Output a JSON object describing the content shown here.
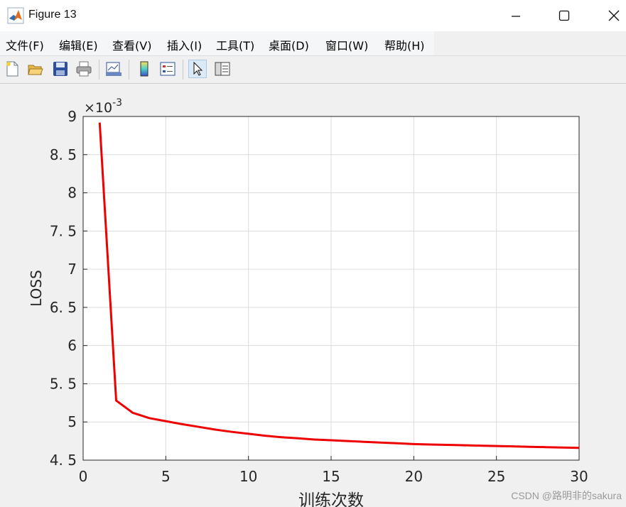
{
  "window": {
    "title": "Figure 13",
    "minimize_icon": "minimize-icon",
    "maximize_icon": "maximize-icon",
    "close_icon": "close-icon"
  },
  "menu": {
    "items": [
      "文件(F)",
      "编辑(E)",
      "查看(V)",
      "插入(I)",
      "工具(T)",
      "桌面(D)",
      "窗口(W)",
      "帮助(H)"
    ]
  },
  "toolbar": {
    "icons": [
      "new-figure-icon",
      "open-file-icon",
      "save-icon",
      "print-icon",
      "link-plot-icon",
      "colorbar-icon",
      "legend-icon",
      "pointer-icon",
      "property-editor-icon"
    ]
  },
  "chart_data": {
    "type": "line",
    "title": "",
    "xlabel": "训练次数",
    "ylabel": "LOSS",
    "exponent_label": "×10",
    "exponent_power": "-3",
    "xlim": [
      0,
      30
    ],
    "ylim": [
      4.5,
      9
    ],
    "xticks": [
      "0",
      "5",
      "10",
      "15",
      "20",
      "25",
      "30"
    ],
    "yticks": [
      "4. 5",
      "5",
      "5. 5",
      "6",
      "6. 5",
      "7",
      "7. 5",
      "8",
      "8. 5",
      "9"
    ],
    "grid": true,
    "series": [
      {
        "color": "#ee0000",
        "x": [
          1,
          2,
          3,
          4,
          5,
          6,
          7,
          8,
          9,
          10,
          11,
          12,
          13,
          14,
          15,
          16,
          17,
          18,
          19,
          20,
          21,
          22,
          23,
          24,
          25,
          26,
          27,
          28,
          29,
          30
        ],
        "values": [
          8.92,
          5.28,
          5.12,
          5.05,
          5.01,
          4.97,
          4.935,
          4.9,
          4.87,
          4.845,
          4.82,
          4.8,
          4.785,
          4.77,
          4.76,
          4.75,
          4.74,
          4.73,
          4.72,
          4.71,
          4.705,
          4.7,
          4.695,
          4.69,
          4.685,
          4.68,
          4.675,
          4.67,
          4.665,
          4.66
        ]
      }
    ]
  },
  "watermark": "CSDN @路明非的sakura"
}
